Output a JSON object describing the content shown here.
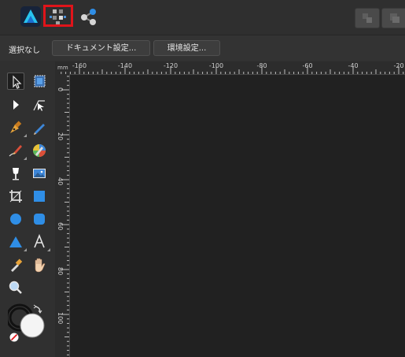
{
  "personas": [
    {
      "name": "Designer Persona",
      "icon": "affinity-designer-logo-icon"
    },
    {
      "name": "Pixel Persona",
      "icon": "pixel-persona-icon"
    },
    {
      "name": "Export Persona",
      "icon": "export-persona-icon"
    }
  ],
  "context_toolbar": {
    "selection_label": "選択なし",
    "document_setup_label": "ドキュメント設定...",
    "preferences_label": "環境設定..."
  },
  "ruler": {
    "unit": "mm",
    "h_labels": [
      "-160",
      "-140",
      "-120",
      "-100",
      "-80",
      "-60",
      "-40",
      "-20"
    ],
    "v_labels": [
      "0",
      "20",
      "40",
      "60",
      "80",
      "100"
    ]
  },
  "tools": [
    "move-tool-icon",
    "artboard-tool-icon",
    "node-tool-icon",
    "corner-tool-icon",
    "pen-tool-icon",
    "pencil-tool-icon",
    "vector-brush-tool-icon",
    "fill-tool-icon",
    "transparency-tool-icon",
    "place-image-tool-icon",
    "crop-tool-icon",
    "rectangle-tool-icon",
    "ellipse-tool-icon",
    "rounded-rectangle-tool-icon",
    "triangle-tool-icon",
    "artistic-text-tool-icon",
    "color-picker-tool-icon",
    "view-tool-icon",
    "zoom-tool-icon"
  ],
  "colors": {
    "highlight": "#e0141a",
    "accent_blue": "#2f8ee6",
    "canvas": "#212121"
  }
}
